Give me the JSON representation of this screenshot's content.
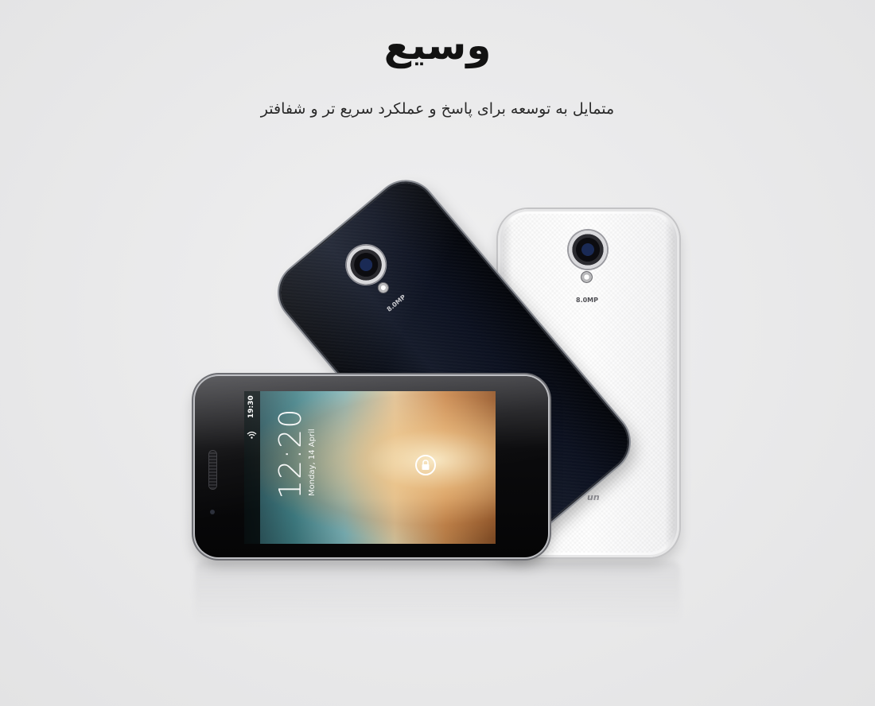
{
  "header": {
    "title": "وسیع",
    "subtitle": "متمایل به توسعه برای پاسخ و عملکرد سریع تر و شفافتر"
  },
  "phones": {
    "white": {
      "camera_label": "8.0MP",
      "brand": "un"
    },
    "black": {
      "camera_label": "8.0MP"
    },
    "front": {
      "status_time": "19:30",
      "clock": "12:20",
      "date": "Monday, 14 April"
    }
  },
  "colors": {
    "background": "#e9e9ea",
    "text": "#121212"
  }
}
